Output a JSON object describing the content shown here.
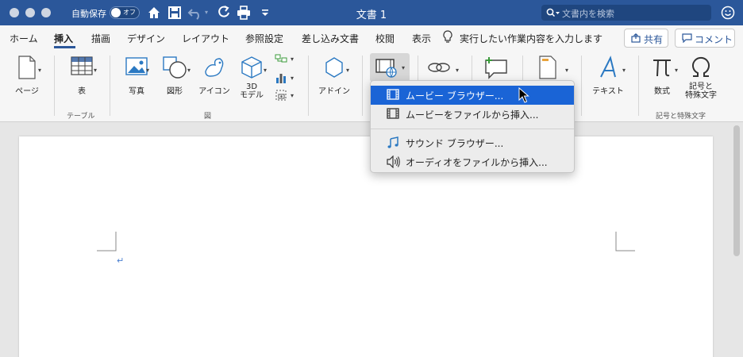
{
  "window": {
    "autosave_label": "自動保存",
    "toggle_state": "オフ",
    "document_title": "文書 1",
    "search_placeholder": "文書内を検索"
  },
  "tabs": [
    {
      "label": "ホーム",
      "active": false
    },
    {
      "label": "挿入",
      "active": true
    },
    {
      "label": "描画",
      "active": false
    },
    {
      "label": "デザイン",
      "active": false
    },
    {
      "label": "レイアウト",
      "active": false
    },
    {
      "label": "参照設定",
      "active": false
    },
    {
      "label": "差し込み文書",
      "active": false
    },
    {
      "label": "校閲",
      "active": false
    },
    {
      "label": "表示",
      "active": false
    }
  ],
  "tell_me": "実行したい作業内容を入力します",
  "share_label": "共有",
  "comment_label": "コメント",
  "ribbon": {
    "page": "ページ",
    "table": "表",
    "table_group": "テーブル",
    "photo": "写真",
    "shapes": "図形",
    "icons": "アイコン",
    "model_3d_line1": "3D",
    "model_3d_line2": "モデル",
    "illustrations_group": "図",
    "addins": "アドイン",
    "textbox": "テキスト",
    "equation": "数式",
    "symbol_line1": "記号と",
    "symbol_line2": "特殊文字",
    "symbols_group": "記号と特殊文字"
  },
  "dropdown": {
    "items": [
      {
        "label": "ムービー ブラウザー...",
        "icon": "film-icon",
        "selected": true
      },
      {
        "label": "ムービーをファイルから挿入...",
        "icon": "film-icon",
        "selected": false
      },
      {
        "label": "サウンド ブラウザー...",
        "icon": "music-note-icon",
        "selected": false
      },
      {
        "label": "オーディオをファイルから挿入...",
        "icon": "speaker-icon",
        "selected": false
      }
    ]
  },
  "document": {
    "paragraph_mark": "↵"
  },
  "colors": {
    "title_bar": "#2b579a",
    "selection": "#1a64d6"
  }
}
